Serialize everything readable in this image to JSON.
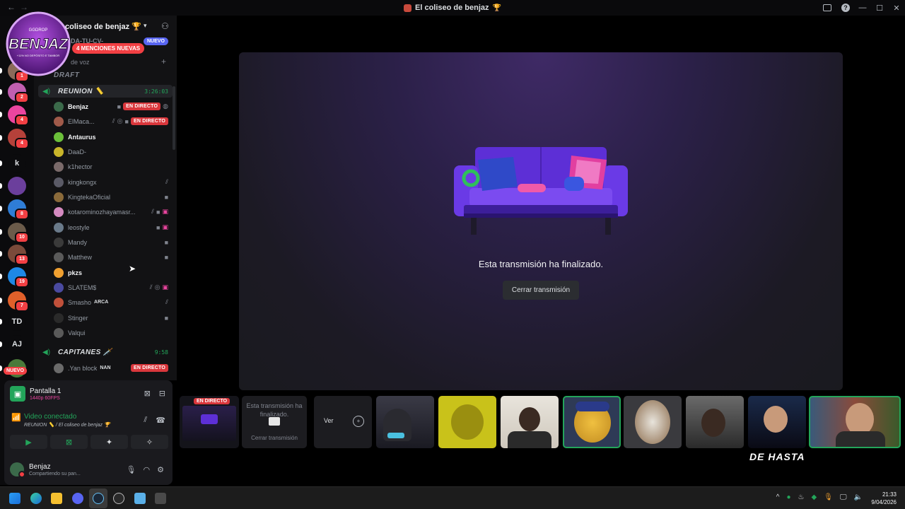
{
  "window": {
    "title": "El coliseo de benjaz",
    "title_emoji": "🏆"
  },
  "server": {
    "name": "coliseo de benjaz",
    "name_emoji": "🏆",
    "logo_text": "BENJAZ",
    "logo_sub_top": "GGDROP",
    "logo_sub_bottom": "+11% NO DEPÓSITO E TAMBOR",
    "partial_channel": "DA-TU-CV-",
    "mention_banner": "4 MENCIONES NUEVAS",
    "nuevo_badge": "NUEVO",
    "category_voice": "de voz",
    "draft_label": "DRAFT"
  },
  "rail": {
    "servers": [
      {
        "label": "",
        "badge": "1",
        "color": "#8b6a5a"
      },
      {
        "label": "",
        "badge": "2",
        "color": "#c15fb0"
      },
      {
        "label": "",
        "badge": "4",
        "color": "#eb459f"
      },
      {
        "label": "",
        "badge": "4",
        "color": "#b5413a"
      },
      {
        "label": "k",
        "badge": "",
        "color": "#0b0b0d"
      },
      {
        "label": "",
        "badge": "",
        "color": "#6b3f9c"
      },
      {
        "label": "",
        "badge": "8",
        "color": "#2f7dd6"
      },
      {
        "label": "",
        "badge": "10",
        "color": "#6b5b4a"
      },
      {
        "label": "",
        "badge": "13",
        "color": "#7a4a3a"
      },
      {
        "label": "",
        "badge": "19",
        "color": "#1e88e5"
      },
      {
        "label": "",
        "badge": "7",
        "color": "#e0602a"
      },
      {
        "label": "TD",
        "badge": "",
        "color": "#0b0b0d"
      },
      {
        "label": "AJ",
        "badge": "",
        "color": "#0b0b0d"
      },
      {
        "label": "",
        "badge": "",
        "color": "#4a7a3a"
      }
    ],
    "nuevo": "NUEVO"
  },
  "channels": {
    "reunion": {
      "name": "REUNION",
      "emoji": "📏",
      "timer": "3:26:03"
    },
    "capitanes": {
      "name": "CAPITANES",
      "emoji": "🗡️",
      "timer": "9:58"
    }
  },
  "members": [
    {
      "name": "Benjaz",
      "bright": true,
      "live": "EN DIRECTO",
      "color": "#3b6a4a"
    },
    {
      "name": "ElMaca...",
      "bright": false,
      "live": "EN DIRECTO",
      "color": "#a05a4a"
    },
    {
      "name": "Antaurus",
      "bright": true,
      "live": "",
      "color": "#6bbf3a"
    },
    {
      "name": "DaaD-",
      "bright": false,
      "live": "",
      "color": "#c9b52a"
    },
    {
      "name": "k1hector",
      "bright": false,
      "live": "",
      "color": "#7a6a6a"
    },
    {
      "name": "kingkongx",
      "bright": false,
      "live": "",
      "color": "#5a5a66"
    },
    {
      "name": "KingtekaOficial",
      "bright": false,
      "live": "",
      "color": "#8a6a3a"
    },
    {
      "name": "kotarominozhayamasr...",
      "bright": false,
      "live": "",
      "color": "#d48ac0"
    },
    {
      "name": "leostyle",
      "bright": false,
      "live": "",
      "color": "#6a7a8a"
    },
    {
      "name": "Mandy",
      "bright": false,
      "live": "",
      "color": "#3a3a3a"
    },
    {
      "name": "Matthew",
      "bright": false,
      "live": "",
      "color": "#5a5a5a"
    },
    {
      "name": "pkzs",
      "bright": true,
      "live": "",
      "color": "#f0a030"
    },
    {
      "name": "SLATEM$",
      "bright": false,
      "live": "",
      "color": "#4a4aa0"
    },
    {
      "name": "Smasho",
      "bright": false,
      "live": "",
      "color": "#c0503a",
      "tag": "ARCA"
    },
    {
      "name": "Stinger",
      "bright": false,
      "live": "",
      "color": "#2a2a2a"
    },
    {
      "name": "Valqui",
      "bright": false,
      "live": "",
      "color": "#5a5a5a"
    },
    {
      "name": ".Yan block",
      "bright": false,
      "live": "EN DIRECTO",
      "color": "#6a6a6a",
      "tag": "NAN"
    }
  ],
  "panel": {
    "screen_title": "Pantalla 1",
    "screen_quality": "1440p 60FPS",
    "voice_status": "Video conectado",
    "voice_location": "REUNION 📏 / El coliseo de benjaz 🏆",
    "user_name": "Benjaz",
    "user_status": "Compartiendo su pan..."
  },
  "stage": {
    "ended_text": "Esta transmisión ha finalizado.",
    "close_button": "Cerrar transmisión"
  },
  "tiles": {
    "live_badge": "EN DIRECTO",
    "ended_text": "Esta transmisión ha finalizado.",
    "close_text": "Cerrar transmisión",
    "ver_label": "Ver",
    "overlay_text": "DE HASTA"
  },
  "taskbar": {
    "time": "21:33",
    "date": "9/04/2026"
  }
}
